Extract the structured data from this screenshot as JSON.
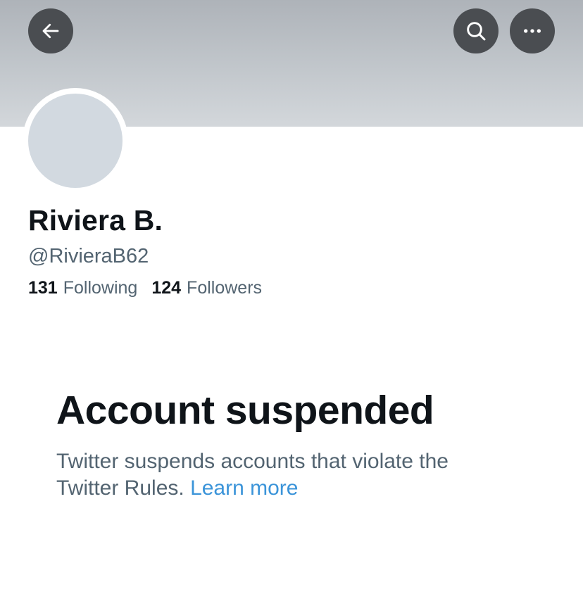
{
  "header": {
    "back_icon": "arrow-left-icon",
    "search_icon": "search-icon",
    "more_icon": "more-horizontal-icon",
    "button_color": "#4a4d51"
  },
  "profile": {
    "display_name": "Riviera B.",
    "handle": "@RivieraB62",
    "following_count": "131",
    "following_label": "Following",
    "followers_count": "124",
    "followers_label": "Followers",
    "avatar_color": "#d2d9e0"
  },
  "suspension": {
    "title": "Account suspended",
    "description_1": "Twitter suspends accounts that violate the",
    "description_2": "Twitter Rules.",
    "learn_more": "Learn more",
    "link_color": "#3b94d9"
  }
}
